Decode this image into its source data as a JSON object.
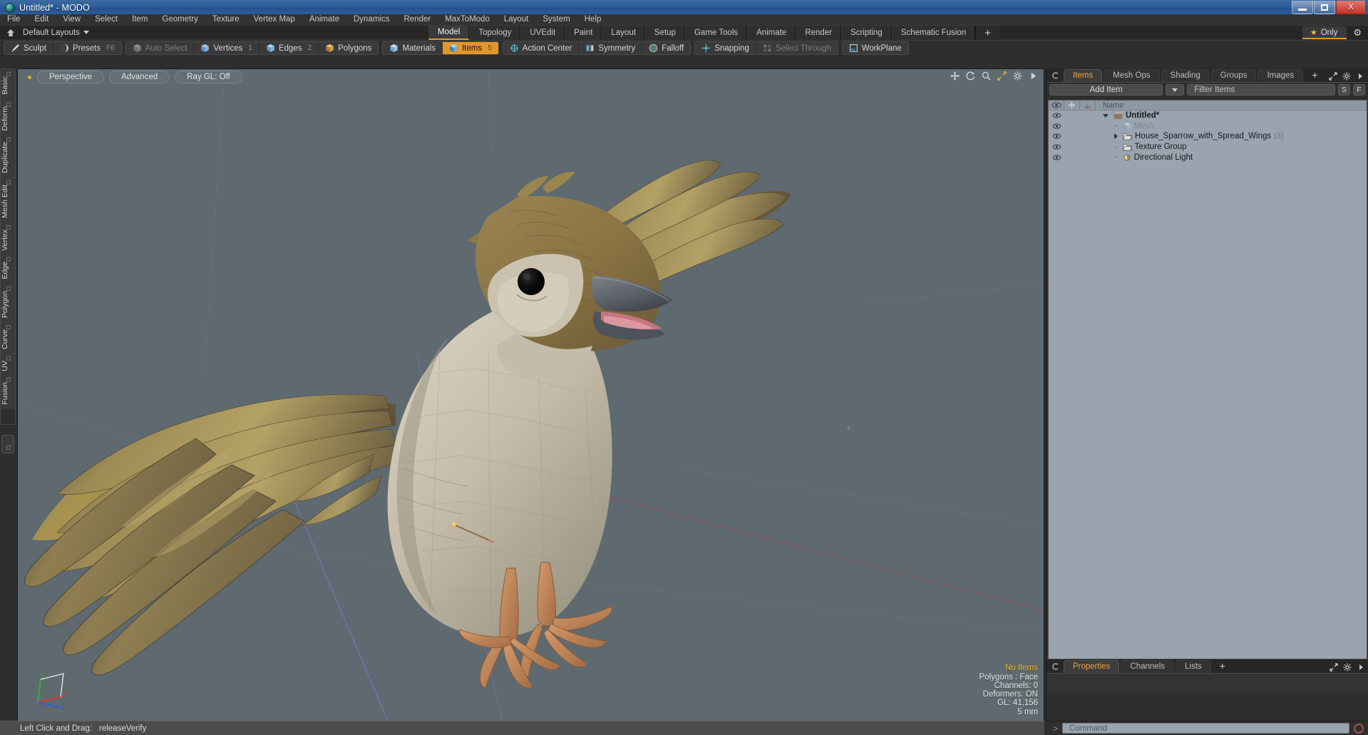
{
  "window": {
    "title": "Untitled* - MODO",
    "app_icon": "modo-logo-icon",
    "minimize_label": "Minimize",
    "maximize_label": "Maximize",
    "close_label": "X"
  },
  "menu": {
    "items": [
      "File",
      "Edit",
      "View",
      "Select",
      "Item",
      "Geometry",
      "Texture",
      "Vertex Map",
      "Animate",
      "Dynamics",
      "Render",
      "MaxToModo",
      "Layout",
      "System",
      "Help"
    ]
  },
  "layout_bar": {
    "home_icon": "home-icon",
    "default_layouts_label": "Default Layouts",
    "tabs": [
      "Model",
      "Topology",
      "UVEdit",
      "Paint",
      "Layout",
      "Setup",
      "Game Tools",
      "Animate",
      "Render",
      "Scripting",
      "Schematic Fusion"
    ],
    "active_tab": "Model",
    "plus_label": "+",
    "only_label": "Only",
    "only_star_icon": "star-icon",
    "gear_icon": "gear-icon"
  },
  "mode_toolbar": {
    "group1": [
      {
        "label": "Sculpt",
        "icon": "brush-icon",
        "state": "normal",
        "num": ""
      },
      {
        "label": "Presets",
        "icon": "sphere-icon",
        "state": "normal",
        "num": "F6"
      }
    ],
    "group2": [
      {
        "label": "Auto Select",
        "icon": "cube-gray-icon",
        "state": "disabled",
        "num": ""
      },
      {
        "label": "Vertices",
        "icon": "cube-vertex-icon",
        "state": "normal",
        "num": "1"
      },
      {
        "label": "Edges",
        "icon": "cube-edge-icon",
        "state": "normal",
        "num": "2"
      },
      {
        "label": "Polygons",
        "icon": "cube-poly-icon",
        "state": "normal",
        "num": ""
      }
    ],
    "group3": [
      {
        "label": "Materials",
        "icon": "cube-material-icon",
        "state": "normal",
        "num": ""
      },
      {
        "label": "Items",
        "icon": "cube-item-icon",
        "state": "active",
        "num": "5"
      }
    ],
    "group4": [
      {
        "label": "Action Center",
        "icon": "crosshair-circle-icon",
        "state": "normal",
        "num": ""
      },
      {
        "label": "Symmetry",
        "icon": "symmetry-icon",
        "state": "normal",
        "num": ""
      },
      {
        "label": "Falloff",
        "icon": "falloff-circle-icon",
        "state": "normal",
        "num": ""
      }
    ],
    "group5": [
      {
        "label": "Snapping",
        "icon": "snapping-icon",
        "state": "normal",
        "num": ""
      },
      {
        "label": "Select Through",
        "icon": "select-through-icon",
        "state": "disabled",
        "num": ""
      }
    ],
    "group6": [
      {
        "label": "WorkPlane",
        "icon": "workplane-icon",
        "state": "normal",
        "num": ""
      }
    ]
  },
  "left_tabs": {
    "items": [
      "Basic",
      "Deform",
      "Duplicate",
      "Mesh Edit",
      "Vertex",
      "Edge",
      "Polygon",
      "Curve",
      "UV",
      "Fusion"
    ]
  },
  "viewport": {
    "view_mode": "Perspective",
    "shading": "Advanced",
    "raygl": "Ray GL: Off",
    "icons": [
      "move-icon",
      "rotate-icon",
      "zoom-icon",
      "expand-icon",
      "gear-icon",
      "play-arrow-icon"
    ],
    "status": {
      "items": "No Items",
      "polygons": "Polygons : Face",
      "channels": "Channels: 0",
      "deformers": "Deformers: ON",
      "gl": "GL: 41,156",
      "grid": "5 mm"
    },
    "gizmo": {
      "x": "X",
      "y": "Y",
      "z": "Z"
    }
  },
  "right_panel": {
    "tabs": [
      "Items",
      "Mesh Ops",
      "Shading",
      "Groups",
      "Images"
    ],
    "active_tab": "Items",
    "plus_label": "+",
    "add_item_label": "Add Item",
    "filter_placeholder": "Filter Items",
    "s_button": "S",
    "f_button": "F",
    "list_header": {
      "name": "Name",
      "eye_icon": "eye-icon",
      "lock_icon": "move-lock-icon",
      "axis_icon": "axis-icon"
    },
    "items": [
      {
        "name": "Untitled*",
        "icon": "scene-icon",
        "depth": 0,
        "bold": true,
        "dim": false,
        "twirl": "down",
        "count": ""
      },
      {
        "name": "Mesh",
        "icon": "mesh-cube-icon",
        "depth": 1,
        "bold": false,
        "dim": true,
        "twirl": "dash",
        "count": ""
      },
      {
        "name": "House_Sparrow_with_Spread_Wings",
        "icon": "folder-icon",
        "depth": 1,
        "bold": false,
        "dim": false,
        "twirl": "right",
        "count": "(3)"
      },
      {
        "name": "Texture Group",
        "icon": "folder-icon",
        "depth": 1,
        "bold": false,
        "dim": false,
        "twirl": "dash",
        "count": ""
      },
      {
        "name": "Directional Light",
        "icon": "light-icon",
        "depth": 1,
        "bold": false,
        "dim": false,
        "twirl": "dash",
        "count": ""
      }
    ]
  },
  "bottom_panel": {
    "tabs": [
      "Properties",
      "Channels",
      "Lists"
    ],
    "active_tab": "Properties",
    "plus_label": "+"
  },
  "command_bar": {
    "prompt": ">",
    "placeholder": "Command",
    "record_icon": "record-icon"
  },
  "status_bar": {
    "hint_label": "Left Click and Drag:",
    "hint_value": "releaseVerify"
  },
  "colors": {
    "accent": "#e2952a",
    "viewport_bg": "#5e6a70",
    "panel_bg": "#2e2e2e",
    "list_bg": "#9aa4ae",
    "axis_x": "#cc3b32",
    "axis_y": "#3fa33f",
    "axis_z": "#2f5fd0"
  }
}
